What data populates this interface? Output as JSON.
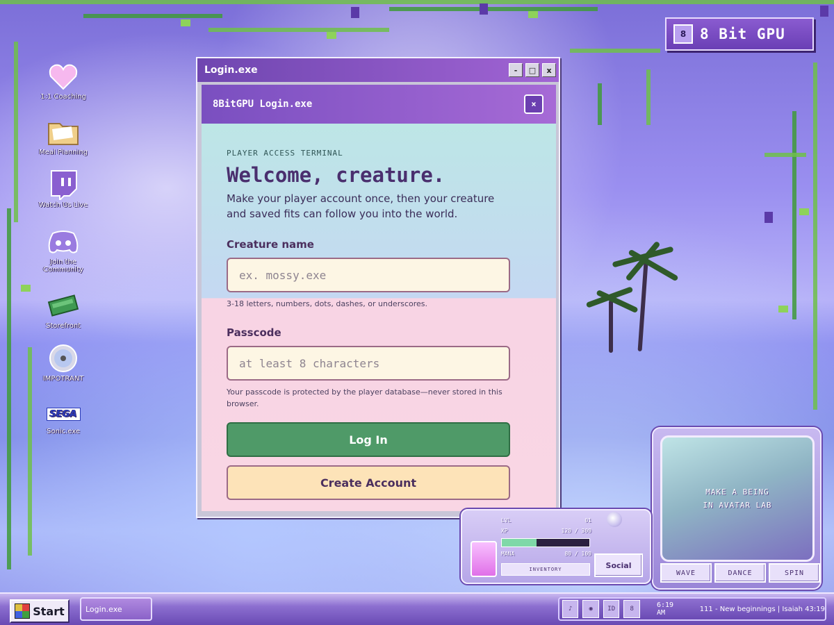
{
  "brand": {
    "logo": "8",
    "name": "8 Bit GPU"
  },
  "desktop_icons": [
    {
      "label": "1:1 Coaching",
      "icon": "heart-icon"
    },
    {
      "label": "Meal Planning",
      "icon": "folder-icon"
    },
    {
      "label": "Watch Us Live",
      "icon": "twitch-icon"
    },
    {
      "label": "Join the Community",
      "icon": "discord-icon"
    },
    {
      "label": "Storefront",
      "icon": "money-icon"
    },
    {
      "label": "IMPOTRANT",
      "icon": "cd-icon"
    },
    {
      "label": "Sonic.exe",
      "icon": "sega-icon",
      "badge": "SEGA"
    }
  ],
  "window": {
    "title": "Login.exe",
    "controls": {
      "minimize": "-",
      "maximize": "□",
      "close": "x"
    },
    "subtitle": "8BitGPU Login.exe",
    "subclose": "×"
  },
  "form": {
    "eyebrow": "PLAYER ACCESS TERMINAL",
    "headline": "Welcome, creature.",
    "lede": "Make your player account once, then your creature and saved fits can follow you into the world.",
    "name_label": "Creature name",
    "name_placeholder": "ex. mossy.exe",
    "name_hint": "3-18 letters, numbers, dots, dashes, or underscores.",
    "pass_label": "Passcode",
    "pass_placeholder": "at least 8 characters",
    "pass_hint": "Your passcode is protected by the player database—never stored in this browser.",
    "login_label": "Log In",
    "create_label": "Create Account"
  },
  "avatar": {
    "prompt_line1": "MAKE A BEING",
    "prompt_line2": "IN AVATAR LAB",
    "buttons": [
      "WAVE",
      "DANCE",
      "SPIN"
    ]
  },
  "stats": {
    "lvl_label": "LVL",
    "lvl_value": "01",
    "xp_label": "XP",
    "xp_value": "120 / 300",
    "xp_fraction": 0.4,
    "mana_label": "MANA",
    "mana_value": "80 / 100",
    "inventory_label": "INVENTORY",
    "social_label": "Social"
  },
  "taskbar": {
    "start_label": "Start",
    "task_item": "Login.exe",
    "tray_icons": [
      "music-icon",
      "discord-icon",
      "id-icon",
      "8-icon"
    ],
    "tray_id_label": "ID",
    "tray_8_label": "8",
    "clock": "6:19 AM",
    "verse": "111 - New beginnings | Isaiah 43:19"
  },
  "colors": {
    "accent_purple": "#7a4fc0",
    "login_green": "#4f9a68",
    "create_peach": "#fde3b8",
    "field_cream": "#fdf6e4"
  }
}
